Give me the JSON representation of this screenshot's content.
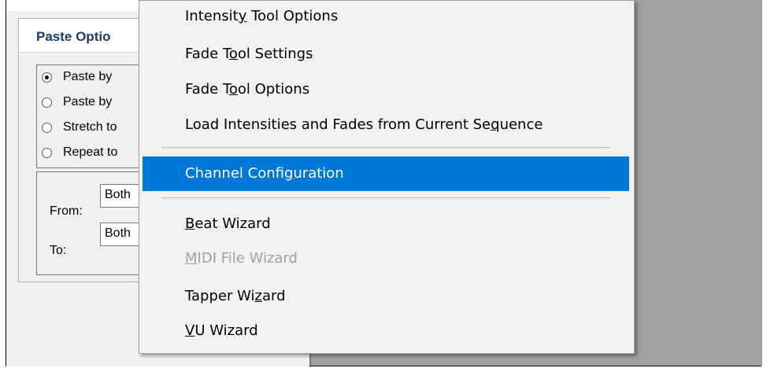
{
  "paste_options": {
    "title": "Paste Optio",
    "radio_options": [
      {
        "label": "Paste by",
        "checked": true
      },
      {
        "label": "Paste by",
        "checked": false
      },
      {
        "label": "Stretch to",
        "checked": false
      },
      {
        "label": "Repeat to",
        "checked": false
      }
    ],
    "from_label": "From:",
    "from_value": "Both",
    "to_label": "To:",
    "to_value": "Both"
  },
  "menu": {
    "items": [
      {
        "pre": "Intensit",
        "mn": "y",
        "post": " Tool Options",
        "state": "normal"
      },
      {
        "pre": "Fade T",
        "mn": "o",
        "post": "ol Settings",
        "state": "normal"
      },
      {
        "pre": "Fade T",
        "mn": "o",
        "post": "ol Options",
        "state": "normal"
      },
      {
        "pre": "Load Intensities and Fades from Current Se",
        "mn": "q",
        "post": "uence",
        "state": "normal"
      },
      {
        "pre": "Channel Confi",
        "mn": "g",
        "post": "uration",
        "state": "highlighted"
      },
      {
        "pre": "",
        "mn": "B",
        "post": "eat Wizard",
        "state": "normal"
      },
      {
        "pre": "",
        "mn": "M",
        "post": "IDI File Wizard",
        "state": "disabled"
      },
      {
        "pre": "Tapper Wi",
        "mn": "z",
        "post": "ard",
        "state": "normal"
      },
      {
        "pre": "",
        "mn": "V",
        "post": "U Wizard",
        "state": "normal"
      }
    ]
  },
  "colors": {
    "highlight": "#0078d7",
    "disabled_text": "#a0a0a0",
    "title_text": "#1e3c6e",
    "desktop_gray": "#a0a0a0"
  }
}
